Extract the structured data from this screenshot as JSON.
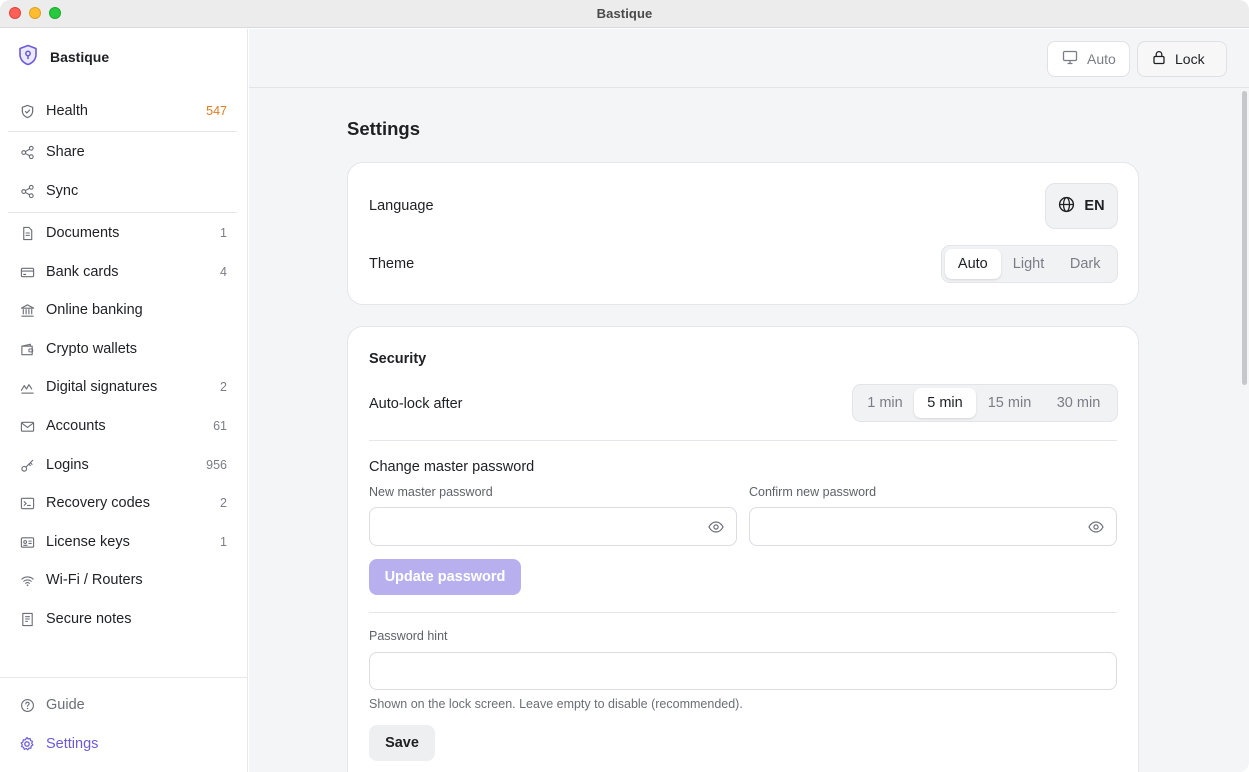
{
  "window": {
    "title": "Bastique"
  },
  "sidebar": {
    "brand": "Bastique",
    "items": [
      {
        "label": "Health",
        "count": "547",
        "icon": "shield-icon"
      },
      {
        "label": "Share",
        "count": "",
        "icon": "share-icon"
      },
      {
        "label": "Sync",
        "count": "",
        "icon": "sync-icon"
      },
      {
        "label": "Documents",
        "count": "1",
        "icon": "document-icon"
      },
      {
        "label": "Bank cards",
        "count": "4",
        "icon": "credit-card-icon"
      },
      {
        "label": "Online banking",
        "count": "",
        "icon": "bank-icon"
      },
      {
        "label": "Crypto wallets",
        "count": "",
        "icon": "wallet-icon"
      },
      {
        "label": "Digital signatures",
        "count": "2",
        "icon": "signature-icon"
      },
      {
        "label": "Accounts",
        "count": "61",
        "icon": "mail-icon"
      },
      {
        "label": "Logins",
        "count": "956",
        "icon": "key-icon"
      },
      {
        "label": "Recovery codes",
        "count": "2",
        "icon": "terminal-icon"
      },
      {
        "label": "License keys",
        "count": "1",
        "icon": "id-card-icon"
      },
      {
        "label": "Wi-Fi / Routers",
        "count": "",
        "icon": "wifi-icon"
      },
      {
        "label": "Secure notes",
        "count": "",
        "icon": "note-icon"
      }
    ],
    "footer": [
      {
        "label": "Guide",
        "icon": "help-icon"
      },
      {
        "label": "Settings",
        "icon": "gear-icon"
      }
    ]
  },
  "topbar": {
    "theme_button": "Auto",
    "lock_button": "Lock"
  },
  "settings": {
    "title": "Settings",
    "language_label": "Language",
    "language_value": "EN",
    "theme_label": "Theme",
    "theme_options": [
      "Auto",
      "Light",
      "Dark"
    ],
    "theme_selected": "Auto",
    "security": {
      "title": "Security",
      "autolock_label": "Auto-lock after",
      "autolock_options": [
        "1 min",
        "5 min",
        "15 min",
        "30 min"
      ],
      "autolock_selected": "5 min",
      "change_password_title": "Change master password",
      "new_password_label": "New master password",
      "new_password_value": "",
      "confirm_password_label": "Confirm new password",
      "confirm_password_value": "",
      "update_button": "Update password",
      "hint_label": "Password hint",
      "hint_value": "",
      "hint_help": "Shown on the lock screen. Leave empty to disable (recommended).",
      "save_button": "Save"
    }
  },
  "colors": {
    "accent": "#6d5bd6",
    "accent_disabled": "#b8b0ee",
    "warning": "#e07b22",
    "background": "#f4f5f7"
  }
}
